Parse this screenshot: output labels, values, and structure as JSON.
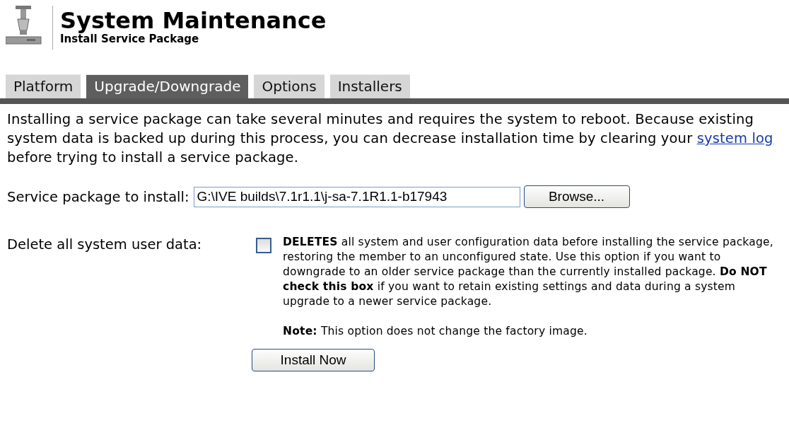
{
  "header": {
    "title": "System Maintenance",
    "subtitle": "Install Service Package"
  },
  "tabs": [
    {
      "label": "Platform",
      "selected": false
    },
    {
      "label": "Upgrade/Downgrade",
      "selected": true
    },
    {
      "label": "Options",
      "selected": false
    },
    {
      "label": "Installers",
      "selected": false
    }
  ],
  "intro": {
    "before": "Installing a service package can take several minutes and requires the system to reboot. Because existing system data is backed up during this process, you can decrease installation time by clearing your ",
    "link": "system log",
    "after": " before trying to install a service package."
  },
  "package_field": {
    "label": "Service package to install:",
    "value": "G:\\IVE builds\\7.1r1.1\\j-sa-7.1R1.1-b17943",
    "button": "Browse..."
  },
  "delete_option": {
    "label": "Delete all system user data:",
    "checked": false,
    "description": "**DELETES** all system and user configuration data before installing the service package, restoring the member to an unconfigured state. Use this option if you want to downgrade to an older service package than the currently installed package. **Do NOT check this box** if you want to retain existing settings and data during a system upgrade to a newer service package.",
    "note": "**Note:** This option does not change the factory image."
  },
  "install_button": "Install Now"
}
